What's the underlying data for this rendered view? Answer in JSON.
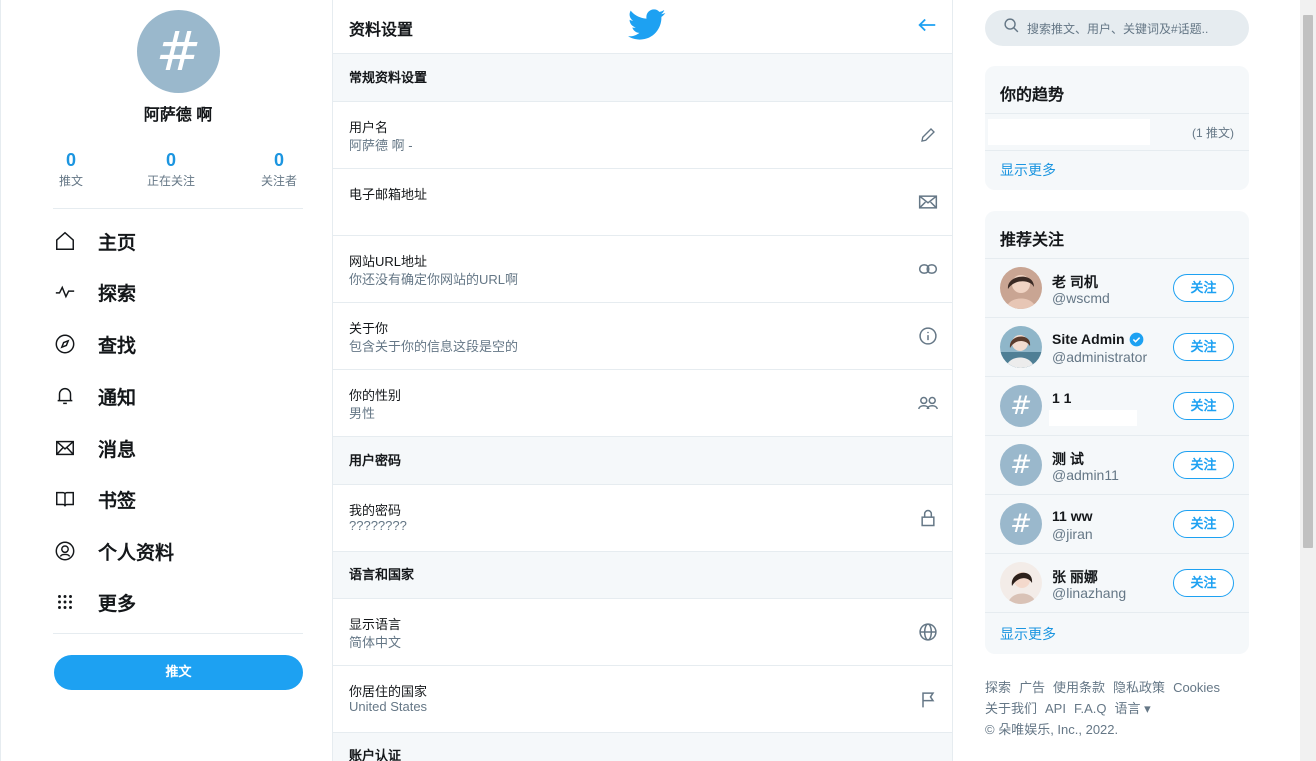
{
  "profile": {
    "name": "阿萨德 啊",
    "avatar_glyph": "#",
    "stats": [
      {
        "value": "0",
        "label": "推文"
      },
      {
        "value": "0",
        "label": "正在关注"
      },
      {
        "value": "0",
        "label": "关注者"
      }
    ]
  },
  "nav": [
    {
      "label": "主页",
      "icon": "home-icon"
    },
    {
      "label": "探索",
      "icon": "pulse-icon"
    },
    {
      "label": "查找",
      "icon": "compass-icon"
    },
    {
      "label": "通知",
      "icon": "bell-icon"
    },
    {
      "label": "消息",
      "icon": "envelope-icon"
    },
    {
      "label": "书签",
      "icon": "book-icon"
    },
    {
      "label": "个人资料",
      "icon": "user-circle-icon"
    },
    {
      "label": "更多",
      "icon": "grid-dots-icon"
    }
  ],
  "tweet_button": "推文",
  "settings": {
    "title": "资料设置",
    "sections": {
      "general": "常规资料设置",
      "password": "用户密码",
      "language": "语言和国家",
      "verification": "账户认证"
    },
    "rows": {
      "username": {
        "label": "用户名",
        "value": "阿萨德 啊 -",
        "icon": "pencil-icon"
      },
      "email": {
        "label": "电子邮箱地址",
        "value": "",
        "icon": "envelope-icon"
      },
      "website": {
        "label": "网站URL地址",
        "value": "你还没有确定你网站的URL啊",
        "icon": "link-icon"
      },
      "about": {
        "label": "关于你",
        "value": "包含关于你的信息这段是空的",
        "icon": "info-icon"
      },
      "gender": {
        "label": "你的性别",
        "value": "男性",
        "icon": "users-icon"
      },
      "password": {
        "label": "我的密码",
        "value": "????????",
        "icon": "lock-icon"
      },
      "display_language": {
        "label": "显示语言",
        "value": "简体中文",
        "icon": "globe-icon"
      },
      "country": {
        "label": "你居住的国家",
        "value": "United States",
        "icon": "flag-icon"
      }
    }
  },
  "search": {
    "placeholder": "搜索推文、用户、关键词及#话题.."
  },
  "trends": {
    "title": "你的趋势",
    "items": [
      {
        "name": "",
        "count": "(1 推文)"
      }
    ],
    "more": "显示更多"
  },
  "who_to_follow": {
    "title": "推荐关注",
    "users": [
      {
        "name": "老 司机",
        "handle": "@wscmd",
        "avatar": "photo",
        "verified": false
      },
      {
        "name": "Site Admin",
        "handle": "@administrator",
        "avatar": "photo",
        "verified": true
      },
      {
        "name": "1 1",
        "handle": "",
        "avatar": "#",
        "verified": false
      },
      {
        "name": "测 试",
        "handle": "@admin11",
        "avatar": "#",
        "verified": false
      },
      {
        "name": "11 ww",
        "handle": "@jiran",
        "avatar": "#",
        "verified": false
      },
      {
        "name": "张 丽娜",
        "handle": "@linazhang",
        "avatar": "photo",
        "verified": false
      }
    ],
    "follow_label": "关注",
    "more": "显示更多"
  },
  "footer": {
    "line1": [
      "探索",
      "广告",
      "使用条款",
      "隐私政策",
      "Cookies"
    ],
    "line2": [
      "关于我们",
      "API",
      "F.A.Q",
      "语言 ▾"
    ],
    "copyright": "© 朵唯娱乐, Inc., 2022."
  },
  "colors": {
    "accent": "#1da1f2",
    "link": "#1b95e0",
    "avatar_bg": "#9ab8cc",
    "muted": "#657786",
    "panel": "#f5f8fa"
  }
}
